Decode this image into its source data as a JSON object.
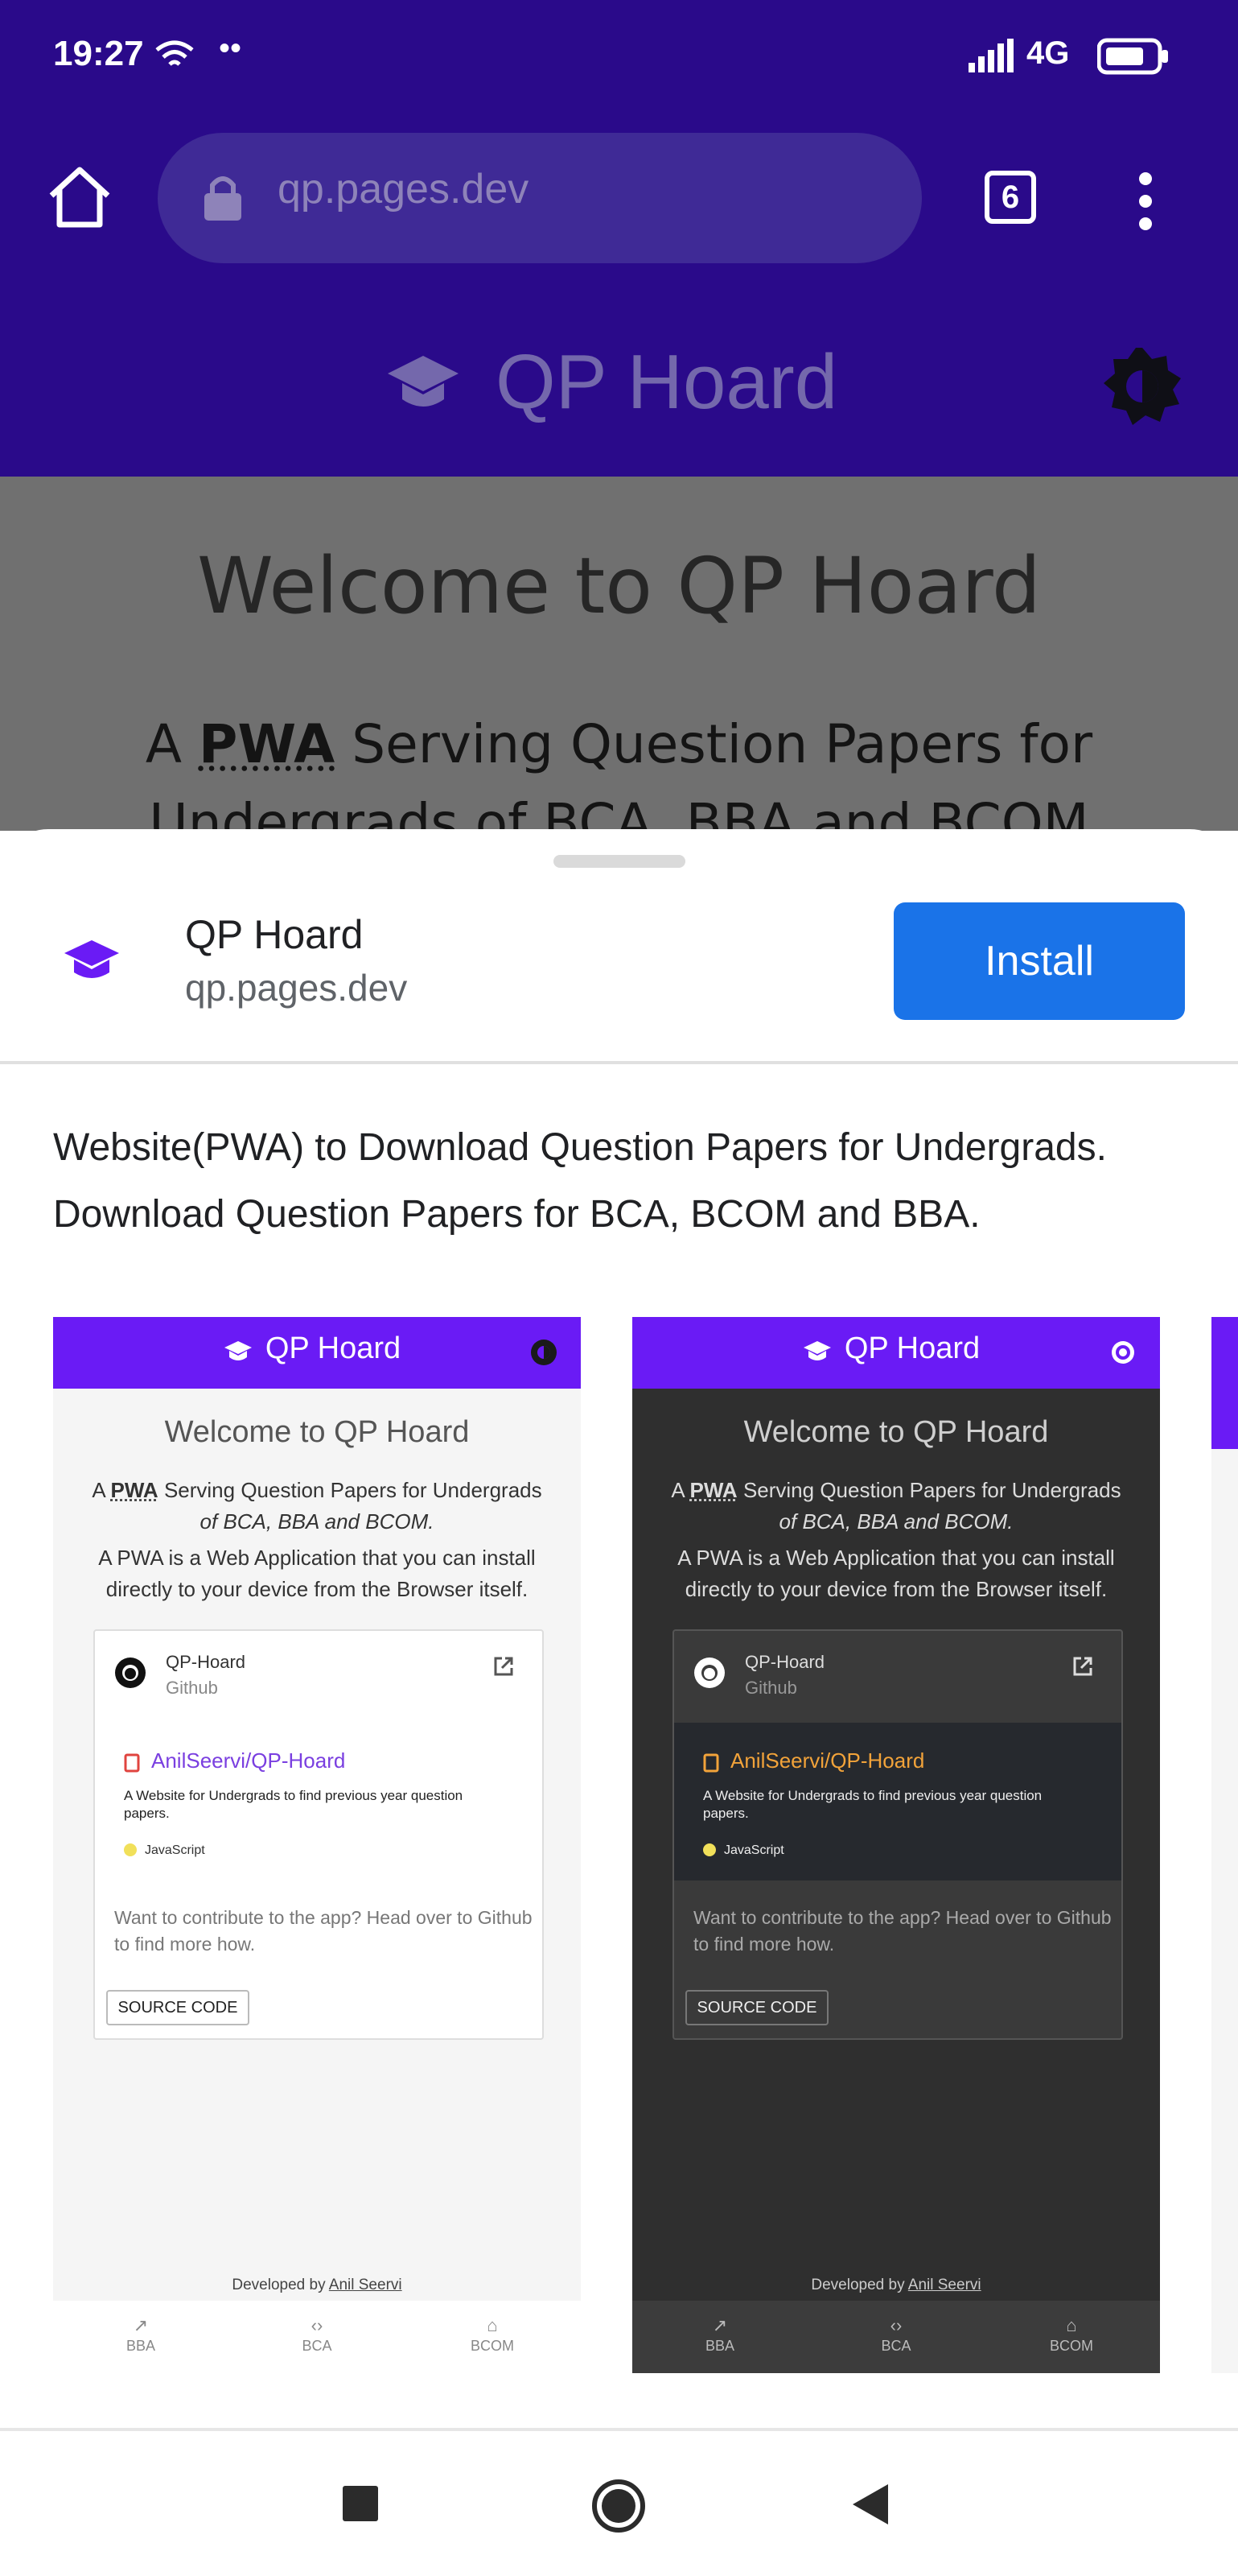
{
  "status_bar": {
    "time": "19:27",
    "dots": "••",
    "network": "4G"
  },
  "browser": {
    "url": "qp.pages.dev",
    "tab_count": "6"
  },
  "app_header": {
    "title": "QP Hoard"
  },
  "page": {
    "welcome": "Welcome to QP Hoard",
    "tagline_prefix": "A ",
    "tagline_pwa": "PWA",
    "tagline_rest": " Serving Question Papers for",
    "tagline_line2": "Undergrads of BCA, BBA and BCOM"
  },
  "install_sheet": {
    "app_name": "QP Hoard",
    "app_url": "qp.pages.dev",
    "install_label": "Install",
    "description": "Website(PWA) to Download Question Papers for Undergrads. Download Question Papers for BCA, BCOM and BBA."
  },
  "screenshot": {
    "title": "QP Hoard",
    "welcome": "Welcome to QP Hoard",
    "line1_prefix": "A ",
    "line1_pwa": "PWA",
    "line1_rest": " Serving Question Papers for Undergrads",
    "line2": "of BCA, BBA and BCOM.",
    "line3": "A PWA is a Web Application that you can install directly to your device from the Browser itself.",
    "card_name": "QP-Hoard",
    "card_sub": "Github",
    "repo_name": "AnilSeervi/QP-Hoard",
    "repo_desc": "A Website for Undergrads to find previous year question papers.",
    "repo_lang": "JavaScript",
    "contribute": "Want to contribute to the app? Head over to Github to find more how.",
    "source_code": "SOURCE CODE",
    "dev_prefix": "Developed by ",
    "dev_name": "Anil Seervi",
    "nav": [
      "BBA",
      "BCA",
      "BCOM"
    ]
  },
  "colors": {
    "chrome": "#2a0a8a",
    "accent": "#6a1bf5",
    "install": "#1a73e8",
    "dark_bg": "#2f2f2f"
  },
  "icons": [
    "wifi-icon",
    "signal-icon",
    "battery-icon",
    "home-icon",
    "lock-icon",
    "tabs-icon",
    "more-icon",
    "graduation-cap-icon",
    "theme-toggle-icon",
    "github-icon",
    "external-link-icon",
    "repo-icon",
    "trending-icon",
    "code-icon",
    "bank-icon",
    "square-nav-icon",
    "circle-nav-icon",
    "back-nav-icon"
  ]
}
